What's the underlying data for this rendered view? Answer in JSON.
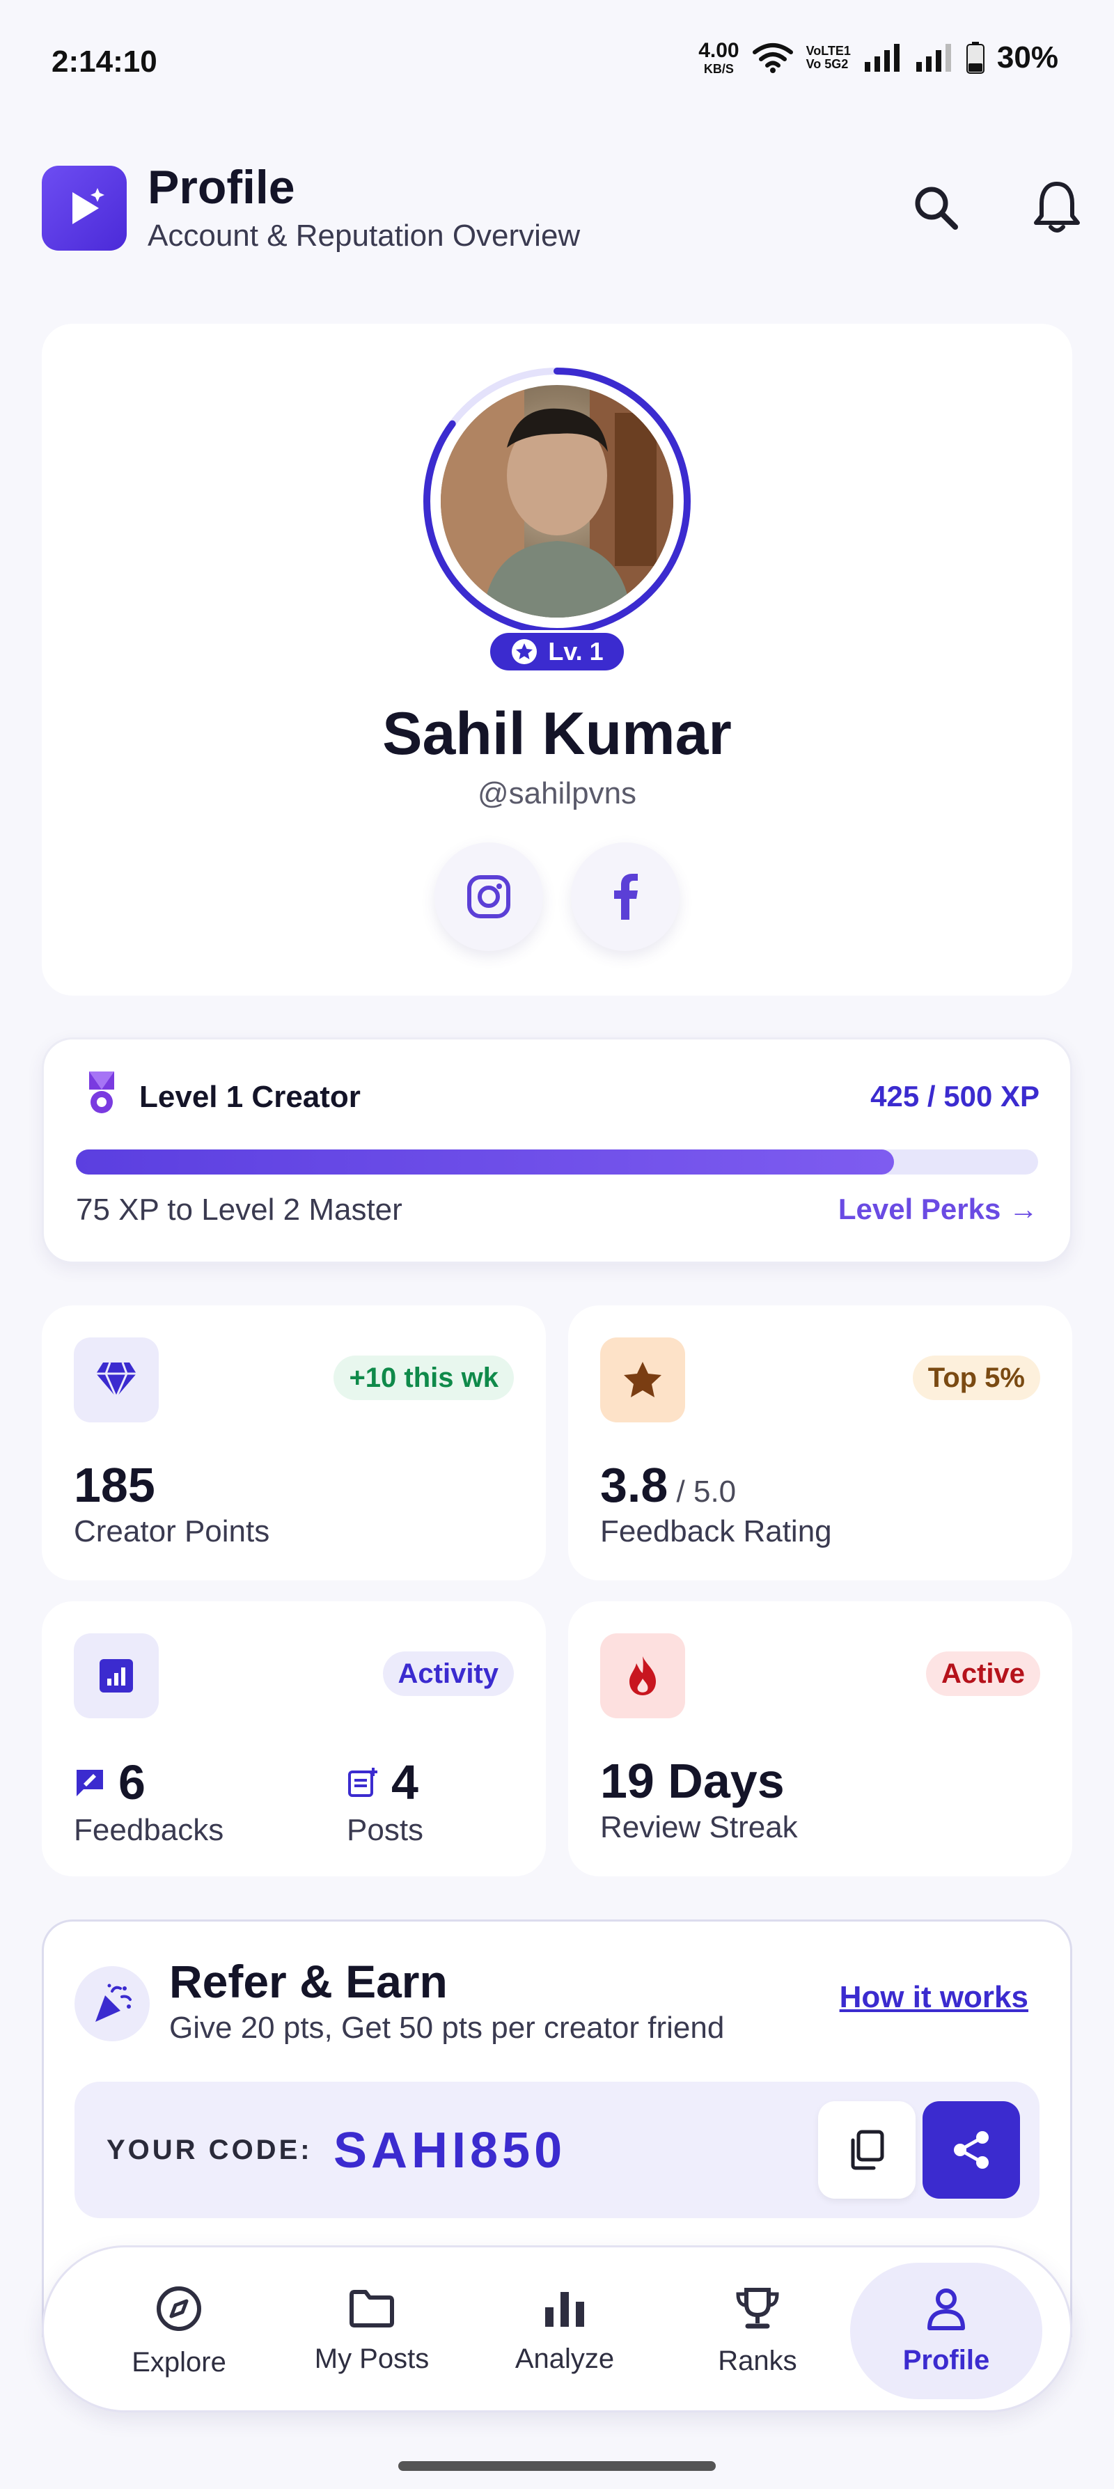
{
  "status_bar": {
    "time": "2:14:10",
    "net_speed": "4.00",
    "net_unit": "KB/S",
    "volte_top": "VoLTE1",
    "volte_bottom": "Vo 5G2",
    "battery": "30%"
  },
  "header": {
    "title": "Profile",
    "subtitle": "Account & Reputation Overview",
    "icons": [
      "play-logo-icon",
      "search-icon",
      "bell-icon"
    ]
  },
  "profile": {
    "name": "Sahil Kumar",
    "handle": "@sahilpvns",
    "level_badge": "Lv. 1",
    "socials": [
      "instagram-icon",
      "facebook-icon"
    ]
  },
  "level": {
    "title": "Level 1 Creator",
    "xp": "425 / 500 XP",
    "progress_fraction": 0.85,
    "next": "75 XP to Level 2 Master",
    "perks_link": "Level Perks →"
  },
  "stats": {
    "points": {
      "tag": "+10 this wk",
      "value": "185",
      "label": "Creator Points",
      "icon": "diamond-icon",
      "tag_color": "#0f8a4a",
      "tag_bg": "#e8f7ee"
    },
    "rating": {
      "tag": "Top 5%",
      "value": "3.8",
      "suffix": " / 5.0",
      "label": "Feedback Rating",
      "icon": "star-icon",
      "tag_color": "#7a4a12",
      "tag_bg": "#fdf0dc"
    },
    "activity": {
      "tag": "Activity",
      "icon": "chart-icon",
      "feedbacks_value": "6",
      "feedbacks_label": "Feedbacks",
      "posts_value": "4",
      "posts_label": "Posts",
      "tag_color": "#3b2bcf",
      "tag_bg": "#ecebfb"
    },
    "streak": {
      "tag": "Active",
      "value": "19 Days",
      "label": "Review Streak",
      "icon": "flame-icon",
      "tag_color": "#b5121b",
      "tag_bg": "#fde4e4"
    }
  },
  "refer": {
    "title": "Refer & Earn",
    "subtitle": "Give 20 pts, Get 50 pts per creator friend",
    "how_link": "How it works",
    "code_label": "YOUR CODE:",
    "code": "SAHI850"
  },
  "nav": [
    {
      "label": "Explore",
      "icon": "compass-icon"
    },
    {
      "label": "My Posts",
      "icon": "folder-icon"
    },
    {
      "label": "Analyze",
      "icon": "bar-chart-icon"
    },
    {
      "label": "Ranks",
      "icon": "trophy-icon"
    },
    {
      "label": "Profile",
      "icon": "user-icon"
    }
  ],
  "colors": {
    "accent": "#3b2bcf",
    "accent_light": "#6a4be3",
    "background": "#f7f7fc"
  }
}
